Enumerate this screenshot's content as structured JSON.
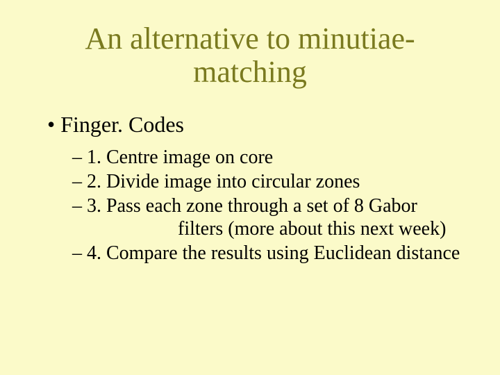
{
  "title_line1": "An alternative to minutiae-",
  "title_line2": "matching",
  "bullets": {
    "level1_0": "Finger. Codes",
    "level2_0": "1. Centre image on core",
    "level2_1": "2. Divide image into circular zones",
    "level2_2": "3. Pass each zone through a set of 8 Gabor",
    "level2_2b": "filters (more about this next week)",
    "level2_3": "4. Compare the results using Euclidean distance"
  }
}
